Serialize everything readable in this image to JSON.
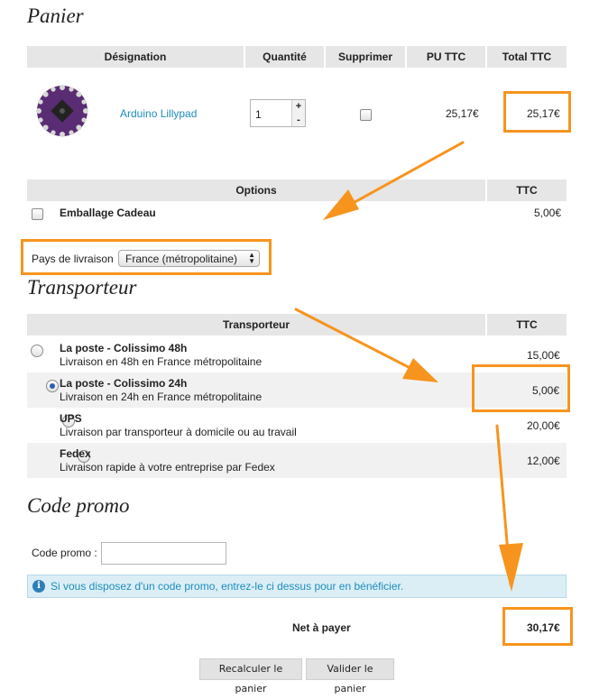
{
  "cart": {
    "heading": "Panier",
    "columns": {
      "designation": "Désignation",
      "quantity": "Quantité",
      "remove": "Supprimer",
      "unit_price": "PU TTC",
      "total": "Total TTC"
    },
    "item": {
      "name": "Arduino Lillypad",
      "quantity": "1",
      "unit_price": "25,17€",
      "total": "25,17€"
    }
  },
  "options": {
    "columns": {
      "options": "Options",
      "ttc": "TTC"
    },
    "gift_wrap": {
      "label": "Emballage Cadeau",
      "price": "5,00€"
    }
  },
  "shipping_country": {
    "label": "Pays de livraison",
    "selected": "France (métropolitaine)"
  },
  "carrier": {
    "heading": "Transporteur",
    "columns": {
      "carrier": "Transporteur",
      "ttc": "TTC"
    },
    "rows": [
      {
        "name": "La poste - Colissimo 48h",
        "desc": "Livraison en 48h en France métropolitaine",
        "price": "15,00€",
        "selected": false
      },
      {
        "name": "La poste - Colissimo 24h",
        "desc": "Livraison en 24h en France métropolitaine",
        "price": "5,00€",
        "selected": true
      },
      {
        "name": "UPS",
        "desc": "Livraison par transporteur à domicile ou au travail",
        "price": "20,00€",
        "selected": false
      },
      {
        "name": "Fedex",
        "desc": "Livraison rapide à votre entreprise par Fedex",
        "price": "12,00€",
        "selected": false
      }
    ]
  },
  "promo": {
    "heading": "Code promo",
    "label": "Code promo :",
    "value": "",
    "info": "Si vous disposez d'un code promo, entrez-le ci dessus pour en bénéficier."
  },
  "total": {
    "label": "Net à payer",
    "value": "30,17€"
  },
  "buttons": {
    "recalculate": "Recalculer le panier",
    "validate": "Valider le panier"
  },
  "colors": {
    "annotation": "#f7941d",
    "link": "#1d8dbb",
    "header_bg": "#e6e6e6",
    "info_bg": "#dbeef6"
  }
}
